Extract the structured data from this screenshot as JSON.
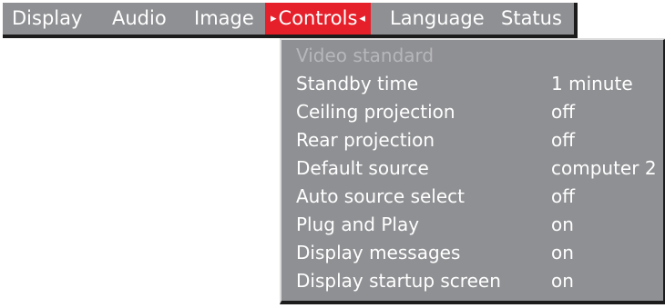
{
  "menu": {
    "tabs": [
      {
        "label": "Display"
      },
      {
        "label": "Audio"
      },
      {
        "label": "Image"
      },
      {
        "label": "Controls",
        "active": true
      },
      {
        "label": "Language"
      },
      {
        "label": "Status"
      }
    ],
    "active_marker_left": "▸",
    "active_marker_right": "◂"
  },
  "controls_menu": {
    "items": [
      {
        "label": "Video standard",
        "value": "",
        "disabled": true
      },
      {
        "label": "Standby time",
        "value": "1 minute"
      },
      {
        "label": "Ceiling projection",
        "value": "off"
      },
      {
        "label": "Rear projection",
        "value": "off"
      },
      {
        "label": "Default source",
        "value": "computer 2"
      },
      {
        "label": "Auto source select",
        "value": "off"
      },
      {
        "label": "Plug and Play",
        "value": "on"
      },
      {
        "label": "Display messages",
        "value": "on"
      },
      {
        "label": "Display startup screen",
        "value": "on"
      }
    ]
  },
  "colors": {
    "panel_bg": "#8f9093",
    "active_tab_bg": "#e5202a",
    "text": "#ffffff",
    "disabled_text": "#b6b7ba",
    "shadow": "#1c1c1c"
  }
}
